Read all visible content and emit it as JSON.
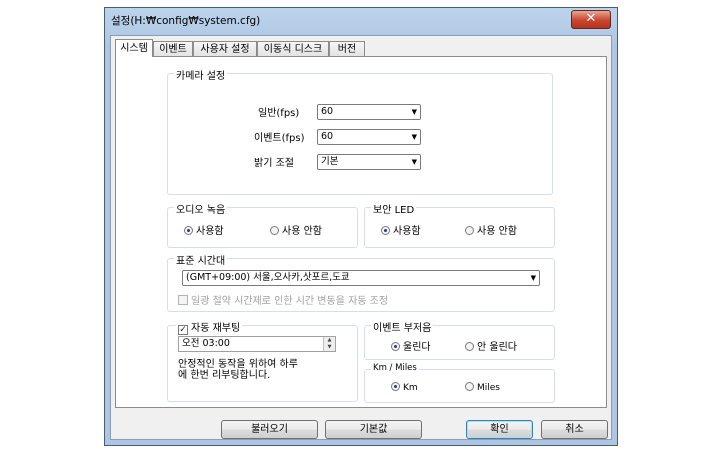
{
  "window": {
    "title": "설정(H:₩config₩system.cfg)",
    "close_label": "✕"
  },
  "tabs": [
    {
      "label": "시스템"
    },
    {
      "label": "이벤트"
    },
    {
      "label": "사용자 설정"
    },
    {
      "label": "이동식 디스크"
    },
    {
      "label": "버전"
    }
  ],
  "camera": {
    "group_label": "카메라 설정",
    "normal_label": "일반(fps)",
    "normal_value": "60",
    "event_label": "이벤트(fps)",
    "event_value": "60",
    "brightness_label": "밝기 조절",
    "brightness_value": "기본"
  },
  "audio": {
    "group_label": "오디오 녹음",
    "on_label": "사용함",
    "off_label": "사용 안함",
    "selected": "on"
  },
  "security_led": {
    "group_label": "보안 LED",
    "on_label": "사용함",
    "off_label": "사용 안함",
    "selected": "on"
  },
  "timezone": {
    "group_label": "표준 시간대",
    "value": "(GMT+09:00) 서울,오사카,삿포르,도쿄",
    "dst_label": "일광 절약 시간제로 인한 시간 변동을 자동 조정",
    "dst_checked": false
  },
  "auto_reboot": {
    "label": "자동 재부팅",
    "checked": true,
    "time_value": "오전  03:00",
    "note": "안정적인 동작을 위하여 하루에 한번 리부팅합니다."
  },
  "event_buzzer": {
    "group_label": "이벤트 부저음",
    "on_label": "울린다",
    "off_label": "안 울린다",
    "selected": "on"
  },
  "units": {
    "group_label": "Km / Miles",
    "km_label": "Km",
    "miles_label": "Miles",
    "selected": "km"
  },
  "footer": {
    "load_label": "불러오기",
    "default_label": "기본값",
    "ok_label": "확인",
    "cancel_label": "취소"
  }
}
